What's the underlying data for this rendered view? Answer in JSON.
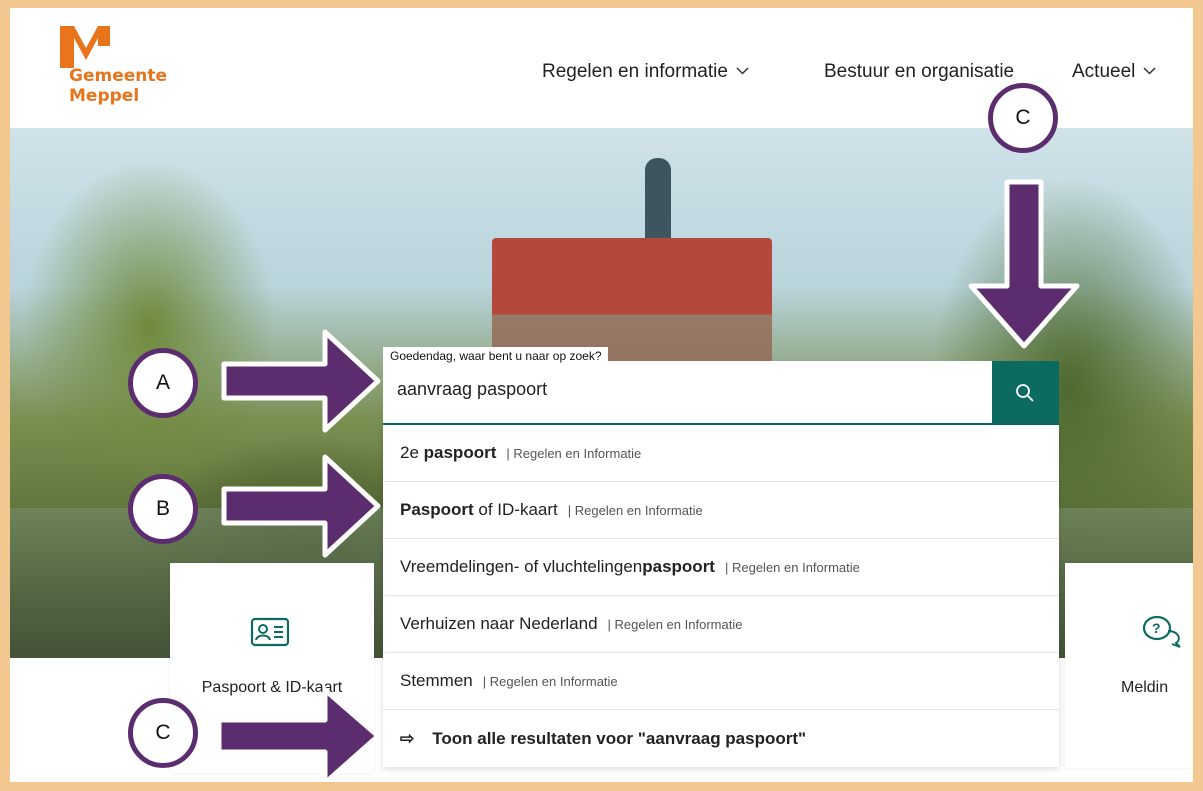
{
  "header": {
    "logo_line1": "Gemeente",
    "logo_line2": "Meppel",
    "nav": [
      {
        "label": "Regelen en informatie",
        "has_dropdown": true
      },
      {
        "label": "Bestuur en organisatie",
        "has_dropdown": false
      },
      {
        "label": "Actueel",
        "has_dropdown": true
      }
    ]
  },
  "search": {
    "label": "Goedendag, waar bent u naar op zoek?",
    "value": "aanvraag paspoort",
    "button_icon": "search-icon"
  },
  "suggestions": [
    {
      "pre": "2e ",
      "bold": "paspoort",
      "post": "",
      "category": "| Regelen en Informatie"
    },
    {
      "pre": "",
      "bold": "Paspoort",
      "post": " of ID-kaart",
      "category": "| Regelen en Informatie"
    },
    {
      "pre": "Vreemdelingen- of vluchtelingen",
      "bold": "paspoort",
      "post": "",
      "category": "| Regelen en Informatie"
    },
    {
      "pre": "Verhuizen naar Nederland",
      "bold": "",
      "post": "",
      "category": "| Regelen en Informatie"
    },
    {
      "pre": "Stemmen",
      "bold": "",
      "post": "",
      "category": "| Regelen en Informatie"
    }
  ],
  "show_all": {
    "arrow": "⇨",
    "label": "Toon alle resultaten voor \"aanvraag paspoort\""
  },
  "cards": [
    {
      "label": "Paspoort & ID-kaart",
      "icon": "id-card-icon"
    },
    {
      "label": "Meldin",
      "icon": "chat-question-icon"
    }
  ],
  "annotations": [
    {
      "letter": "A"
    },
    {
      "letter": "B"
    },
    {
      "letter": "C"
    },
    {
      "letter": "C"
    }
  ],
  "colors": {
    "brand_orange": "#e8741c",
    "teal": "#0b6b61",
    "annotation_purple": "#5c2d6e",
    "frame": "#f3c890"
  }
}
